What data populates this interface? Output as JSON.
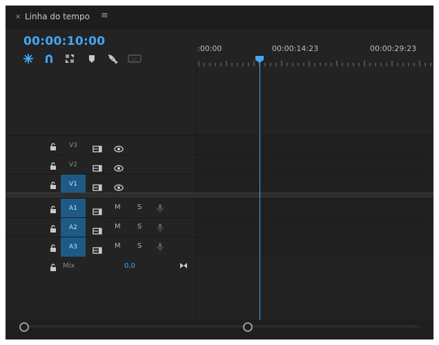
{
  "panel": {
    "close_glyph": "×",
    "title": "Linha do tempo",
    "menu_glyph": "≡"
  },
  "timecode": "00:00:10:00",
  "toolbar": {
    "tools": [
      {
        "name": "insert-nest-icon",
        "color": "#3fa9f5"
      },
      {
        "name": "snap-magnet-icon",
        "color": "#3fa9f5"
      },
      {
        "name": "linked-selection-icon",
        "color": "#9a9a9a"
      },
      {
        "name": "add-marker-icon",
        "color": "#c9c9c9"
      },
      {
        "name": "wrench-icon",
        "color": "#c9c9c9"
      },
      {
        "name": "captions-icon",
        "color": "#5a5a5a"
      }
    ]
  },
  "ruler": {
    "labels": [
      ":00:00",
      "00:00:14:23",
      "00:00:29:23"
    ]
  },
  "tracks": {
    "video": [
      {
        "label": "V3",
        "selected": false
      },
      {
        "label": "V2",
        "selected": false
      },
      {
        "label": "V1",
        "selected": true
      }
    ],
    "audio": [
      {
        "label": "A1",
        "selected": true,
        "mute": "M",
        "solo": "S"
      },
      {
        "label": "A2",
        "selected": true,
        "mute": "M",
        "solo": "S"
      },
      {
        "label": "A3",
        "selected": true,
        "mute": "M",
        "solo": "S"
      }
    ],
    "mix": {
      "label": "Mix",
      "value": "0,0"
    }
  },
  "colors": {
    "accent": "#3fa9f5",
    "panel_bg": "#232323",
    "track_selected": "#1d5a86"
  }
}
